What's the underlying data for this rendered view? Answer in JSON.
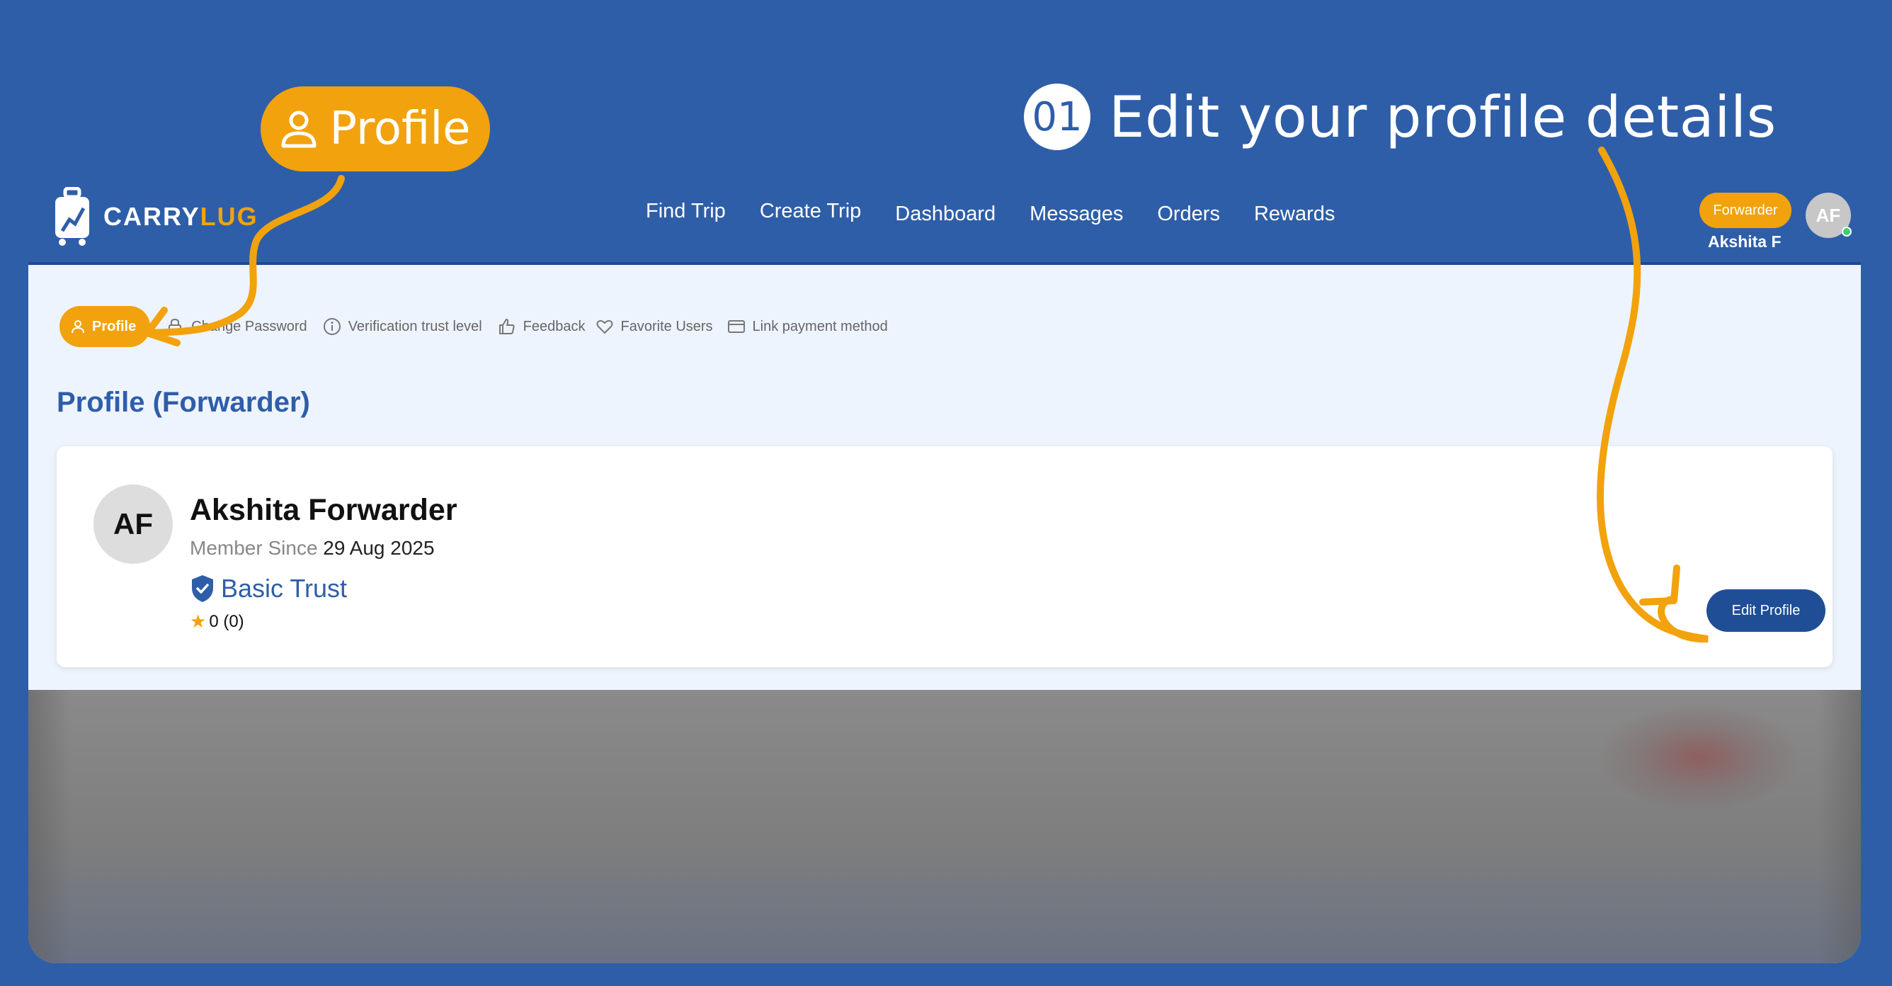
{
  "callout": {
    "label": "Profile",
    "icon": "user-icon"
  },
  "step": {
    "number": "01",
    "title": "Edit your profile details"
  },
  "brand": {
    "name_part1": "C",
    "name_part2": "ARRY",
    "name_part3": "LUG",
    "accent": "#f2a20c",
    "primary": "#2f5ea8"
  },
  "nav": {
    "items": [
      {
        "label": "Find Trip"
      },
      {
        "label": "Create Trip"
      },
      {
        "label": "Dashboard"
      },
      {
        "label": "Messages"
      },
      {
        "label": "Orders"
      },
      {
        "label": "Rewards"
      }
    ],
    "role_badge": "Forwarder",
    "user_name": "Akshita F",
    "avatar_initials": "AF"
  },
  "tabs": [
    {
      "label": "Profile",
      "icon": "user-icon"
    },
    {
      "label": "Change Password",
      "icon": "lock-icon"
    },
    {
      "label": "Verification trust level",
      "icon": "info-icon"
    },
    {
      "label": "Feedback",
      "icon": "thumbs-up-icon"
    },
    {
      "label": "Favorite Users",
      "icon": "heart-icon"
    },
    {
      "label": "Link payment method",
      "icon": "credit-card-icon"
    }
  ],
  "page": {
    "heading": "Profile (Forwarder)"
  },
  "profile": {
    "initials": "AF",
    "full_name": "Akshita Forwarder",
    "member_since_label": "Member Since",
    "member_since_date": "29 Aug 2025",
    "trust_level": "Basic Trust",
    "trust_icon": "shield-check-icon",
    "rating": "0 (0)",
    "edit_button": "Edit Profile"
  }
}
